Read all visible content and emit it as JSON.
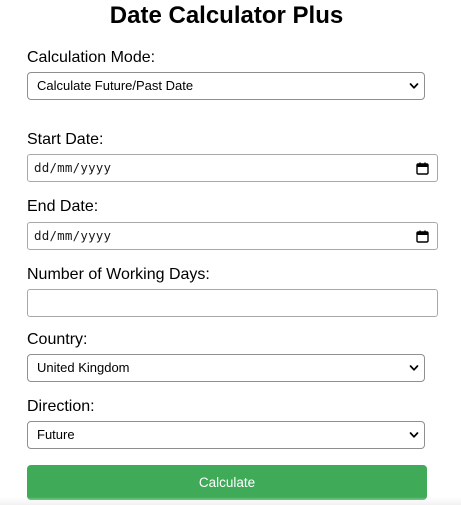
{
  "title": "Date Calculator Plus",
  "form": {
    "calculation_mode": {
      "label": "Calculation Mode:",
      "selected": "Calculate Future/Past Date"
    },
    "start_date": {
      "label": "Start Date:",
      "placeholder": "dd/mm/yyyy"
    },
    "end_date": {
      "label": "End Date:",
      "placeholder": "dd/mm/yyyy"
    },
    "working_days": {
      "label": "Number of Working Days:",
      "value": ""
    },
    "country": {
      "label": "Country:",
      "selected": "United Kingdom"
    },
    "direction": {
      "label": "Direction:",
      "selected": "Future"
    },
    "calculate_label": "Calculate"
  },
  "colors": {
    "button_bg": "#3faa58",
    "button_text": "#ffffff",
    "border": "#8f8f8f"
  },
  "icons": {
    "select_arrow": "chevron-down-icon",
    "date_picker": "calendar-icon"
  }
}
